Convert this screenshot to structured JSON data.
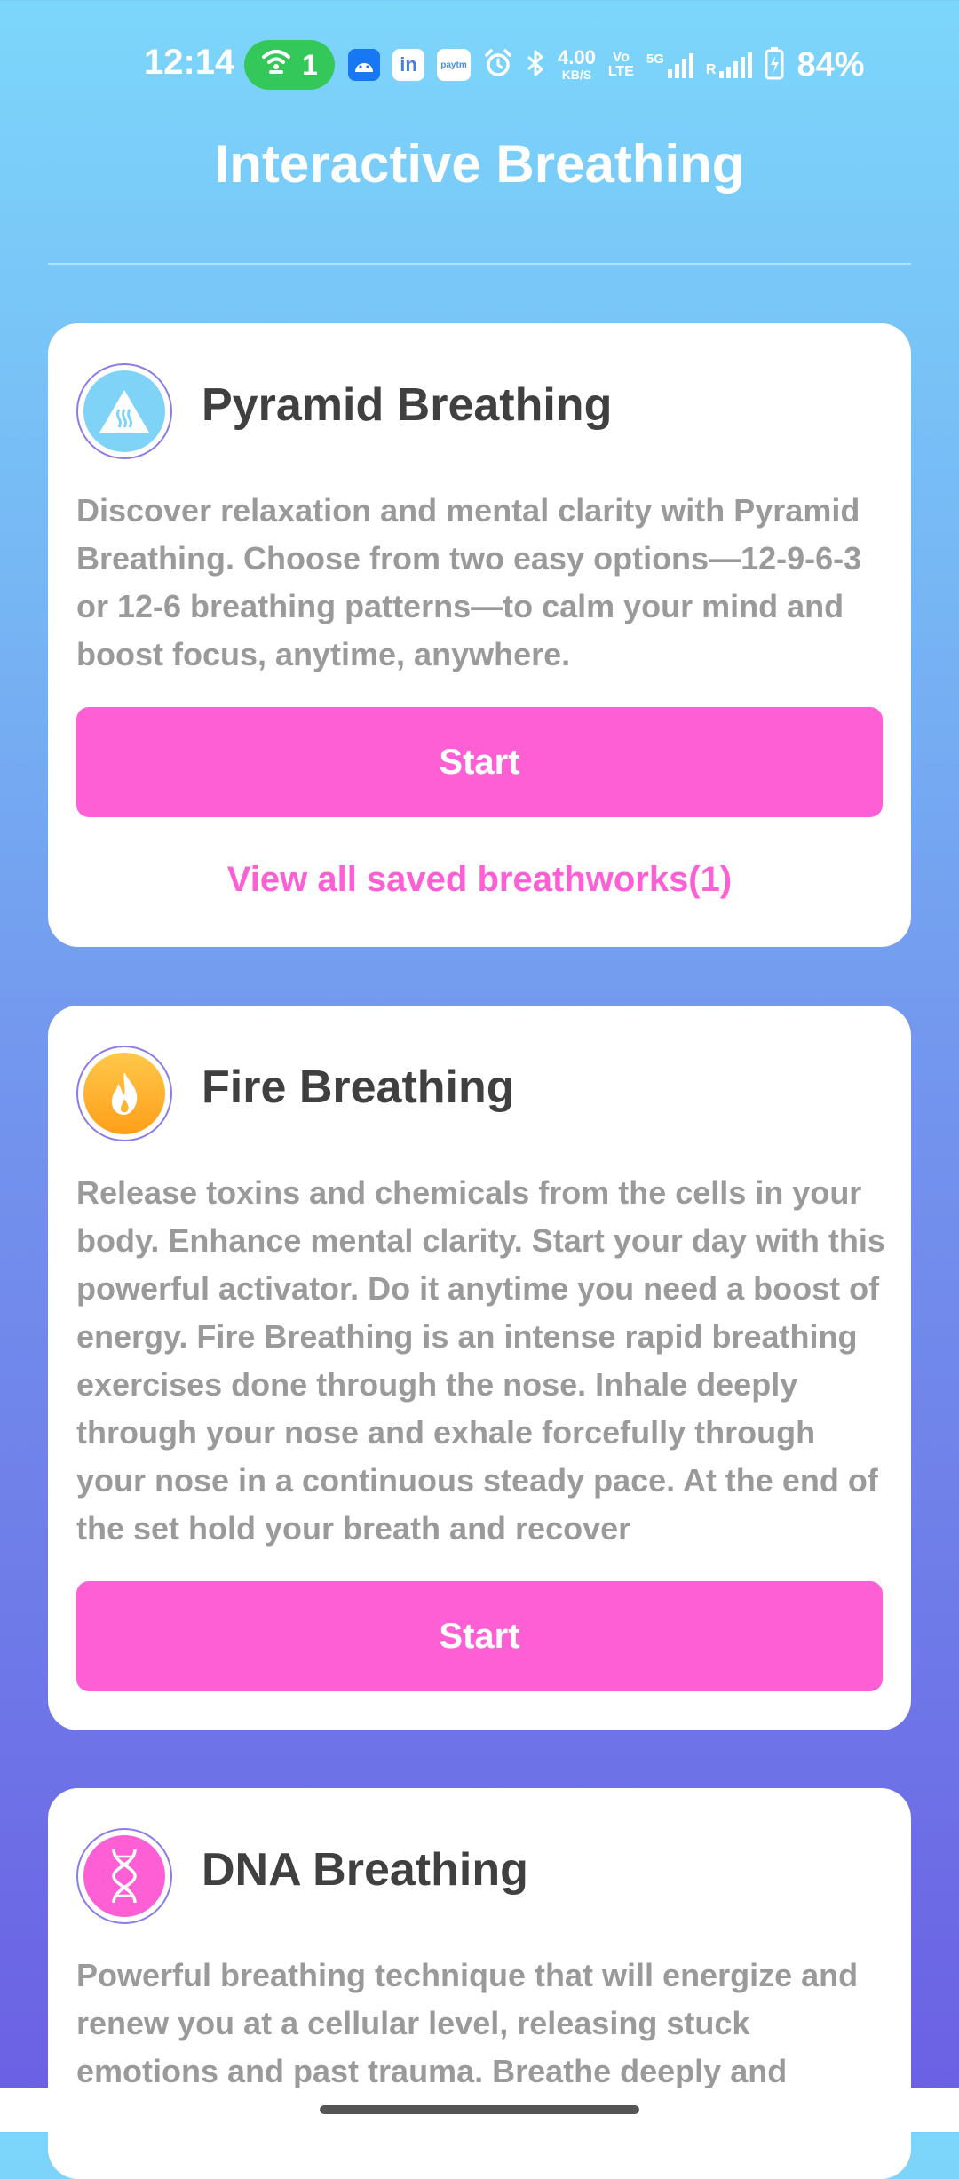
{
  "status_bar": {
    "time": "12:14",
    "hotspot_count": "1",
    "net_speed_value": "4.00",
    "net_speed_unit": "KB/S",
    "volte_top": "Vo",
    "volte_bottom": "LTE",
    "network_5g": "5G",
    "roaming": "R",
    "battery": "84%",
    "app_icons": [
      "android-icon",
      "linkedin-icon",
      "paytm-icon"
    ],
    "paytm_label": "paytm"
  },
  "header": {
    "title": "Interactive Breathing"
  },
  "cards": [
    {
      "title": "Pyramid Breathing",
      "description": "Discover relaxation and mental clarity with Pyramid Breathing. Choose from two easy options—12-9-6-3 or 12-6 breathing patterns—to calm your mind and boost focus, anytime, anywhere.",
      "button_label": "Start",
      "link_label": "View all saved breathworks(1)",
      "icon": "pyramid-icon",
      "icon_color": "#7fd3f7"
    },
    {
      "title": "Fire Breathing",
      "description": "Release toxins and chemicals from the cells in your body. Enhance mental clarity. Start your day with this powerful activator.  Do it anytime you need a boost of energy. Fire Breathing is an intense rapid breathing exercises done through the nose.  Inhale deeply through your nose and exhale forcefully through your nose in a continuous steady pace.  At the end of the set hold your breath and recover",
      "button_label": "Start",
      "icon": "flame-icon",
      "icon_color": "#ffb52e"
    },
    {
      "title": "DNA Breathing",
      "description": "Powerful breathing technique that will energize and renew you at a cellular level, releasing stuck emotions and past trauma.  Breathe deeply and",
      "icon": "dna-icon",
      "icon_color": "#ff5fd4"
    }
  ],
  "colors": {
    "accent": "#ff5fd4",
    "title_text": "#404040",
    "body_text": "#9a9a9a",
    "gradient_top": "#7cd6fb",
    "gradient_bottom": "#6b5ee3"
  }
}
